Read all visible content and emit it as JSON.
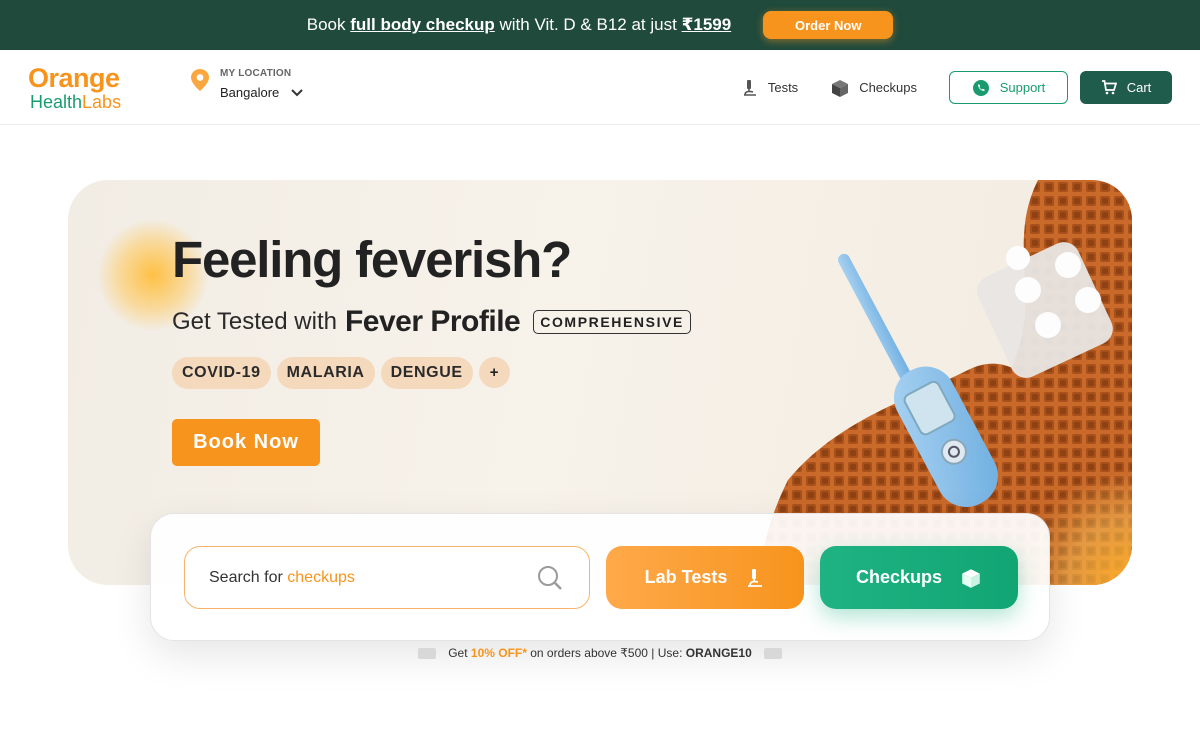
{
  "promo": {
    "pre": "Book ",
    "highlight": "full body checkup",
    "mid": " with Vit. D & B12 at just ",
    "price": "₹1599",
    "cta": "Order Now"
  },
  "header": {
    "logo_top": "Orange",
    "logo_bottom_a": "Health",
    "logo_bottom_b": "Labs",
    "location_label": "MY LOCATION",
    "location_city": "Bangalore",
    "nav_tests": "Tests",
    "nav_checkups": "Checkups",
    "support": "Support",
    "cart": "Cart"
  },
  "hero": {
    "headline": "Feeling feverish?",
    "sub_a": "Get Tested with",
    "sub_b": "Fever Profile",
    "badge": "COMPREHENSIVE",
    "chips": [
      "COVID-19",
      "MALARIA",
      "DENGUE"
    ],
    "chip_more": "+",
    "cta": "Book Now"
  },
  "search": {
    "prefix": "Search for ",
    "keyword": "checkups",
    "lab_tests": "Lab Tests",
    "checkups": "Checkups"
  },
  "coupon": {
    "pre": "Get ",
    "percent": "10% OFF*",
    "mid": " on orders above ₹500 | Use: ",
    "code": "ORANGE10"
  },
  "colors": {
    "brand_orange": "#f7941d",
    "brand_green": "#1a9b6f",
    "promo_bg": "#1f4a3c"
  }
}
